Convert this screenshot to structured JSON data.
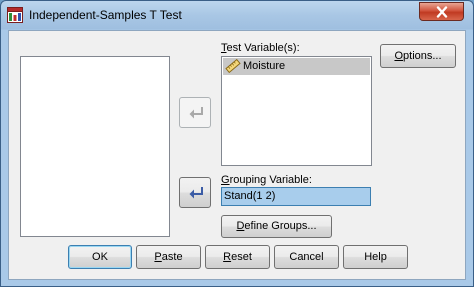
{
  "window": {
    "title": "Independent-Samples T Test",
    "close_symbol": "✕"
  },
  "test_variables": {
    "label": "Test Variable(s):",
    "items": [
      {
        "label": "Moisture",
        "icon": "ruler-icon"
      }
    ]
  },
  "grouping": {
    "label": "Grouping Variable:",
    "value": "Stand(1 2)"
  },
  "buttons": {
    "options": "Options...",
    "define_groups": "Define Groups...",
    "ok": "OK",
    "paste": "Paste",
    "reset": "Reset",
    "cancel": "Cancel",
    "help": "Help"
  },
  "colors": {
    "selected_field": "#a8cdec",
    "selected_item": "#c8c8c8",
    "arrow_enabled": "#3b5ca6",
    "arrow_disabled": "#a9a9a9",
    "close_button": "#c8442c"
  }
}
